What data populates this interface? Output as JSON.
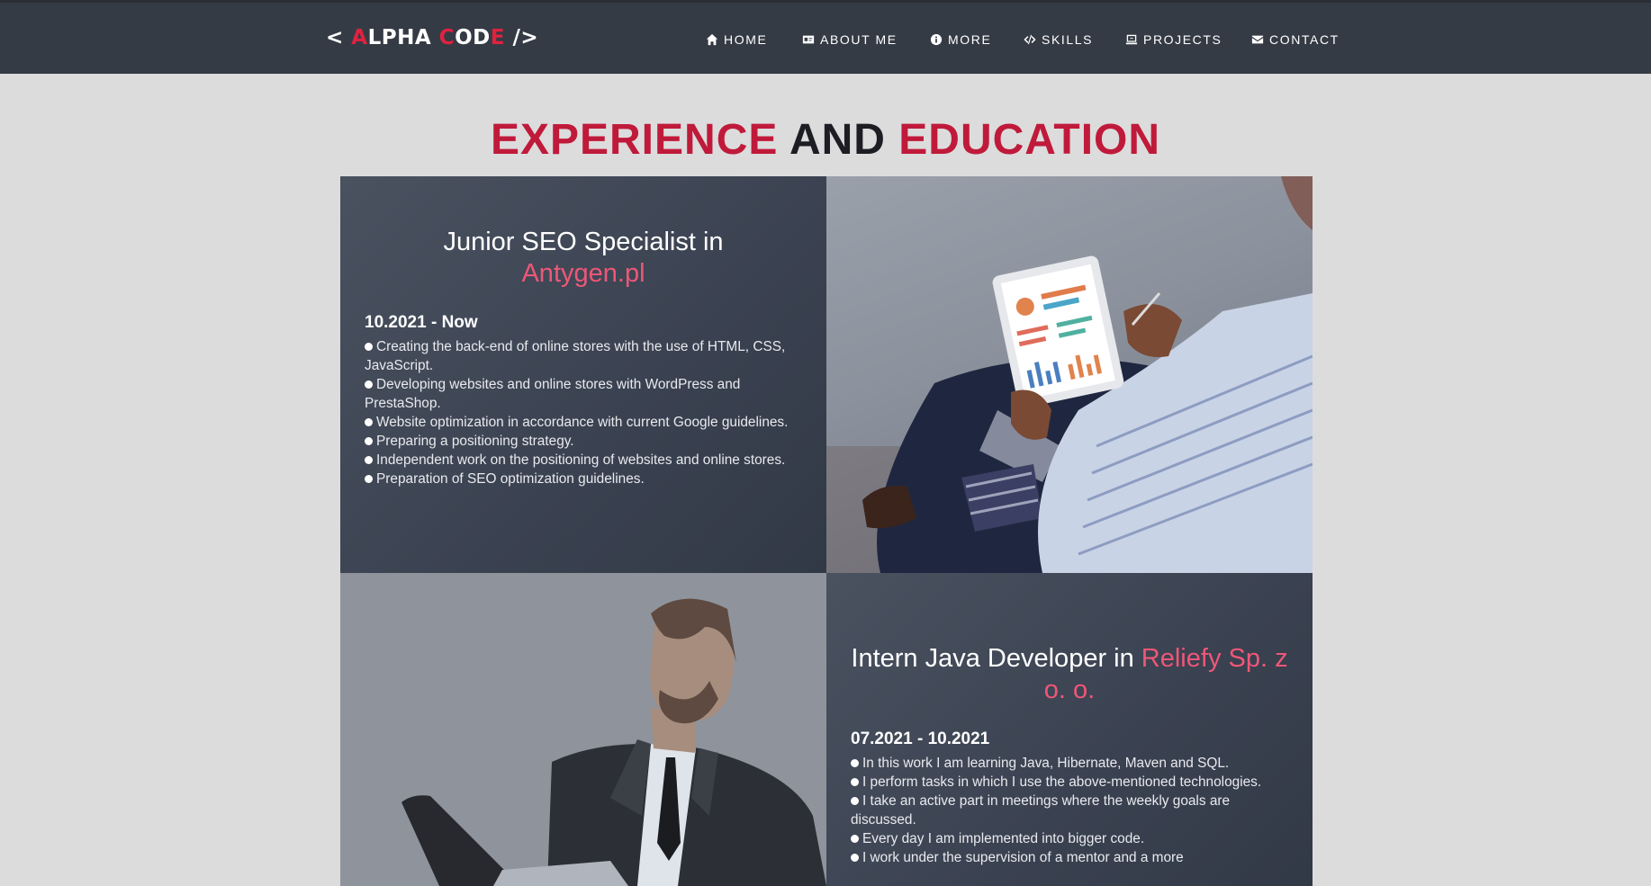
{
  "nav": {
    "logo": {
      "open": "< ",
      "a": "A",
      "lpha": "LPHA ",
      "c": "C",
      "od": "OD",
      "e": "E",
      "close": " />"
    },
    "items": [
      {
        "label": "HOME",
        "icon": "home-icon"
      },
      {
        "label": "ABOUT ME",
        "icon": "id-card-icon"
      },
      {
        "label": "MORE",
        "icon": "info-icon"
      },
      {
        "label": "SKILLS",
        "icon": "code-icon"
      },
      {
        "label": "PROJECTS",
        "icon": "laptop-icon"
      },
      {
        "label": "CONTACT",
        "icon": "envelope-icon"
      }
    ]
  },
  "section": {
    "part1": "EXPERIENCE",
    "part2": "AND",
    "part3": "EDUCATION"
  },
  "jobs": [
    {
      "title": "Junior SEO Specialist in",
      "company": "Antygen.pl",
      "period": "10.2021 - Now",
      "bullets": [
        "Creating the back-end of online stores with the use of HTML, CSS, JavaScript.",
        "Developing websites and online stores with WordPress and PrestaShop.",
        "Website optimization in accordance with current Google guidelines.",
        "Preparing a positioning strategy.",
        "Independent work on the positioning of websites and online stores.",
        "Preparation of SEO optimization guidelines."
      ]
    },
    {
      "title": "Intern Java Developer in",
      "company": "Reliefy Sp. z o. o.",
      "period": "07.2021 - 10.2021",
      "bullets": [
        "In this work I am learning Java, Hibernate, Maven and SQL.",
        "I perform tasks in which I use the above-mentioned technologies.",
        "I take an active part in meetings where the weekly goals are discussed.",
        "Every day I am implemented into bigger code.",
        "I work under the supervision of a mentor and a more"
      ]
    }
  ],
  "colors": {
    "navbar": "#353b45",
    "accent": "#c01a3b",
    "company": "#ee5778",
    "background": "#dcdcdc"
  }
}
